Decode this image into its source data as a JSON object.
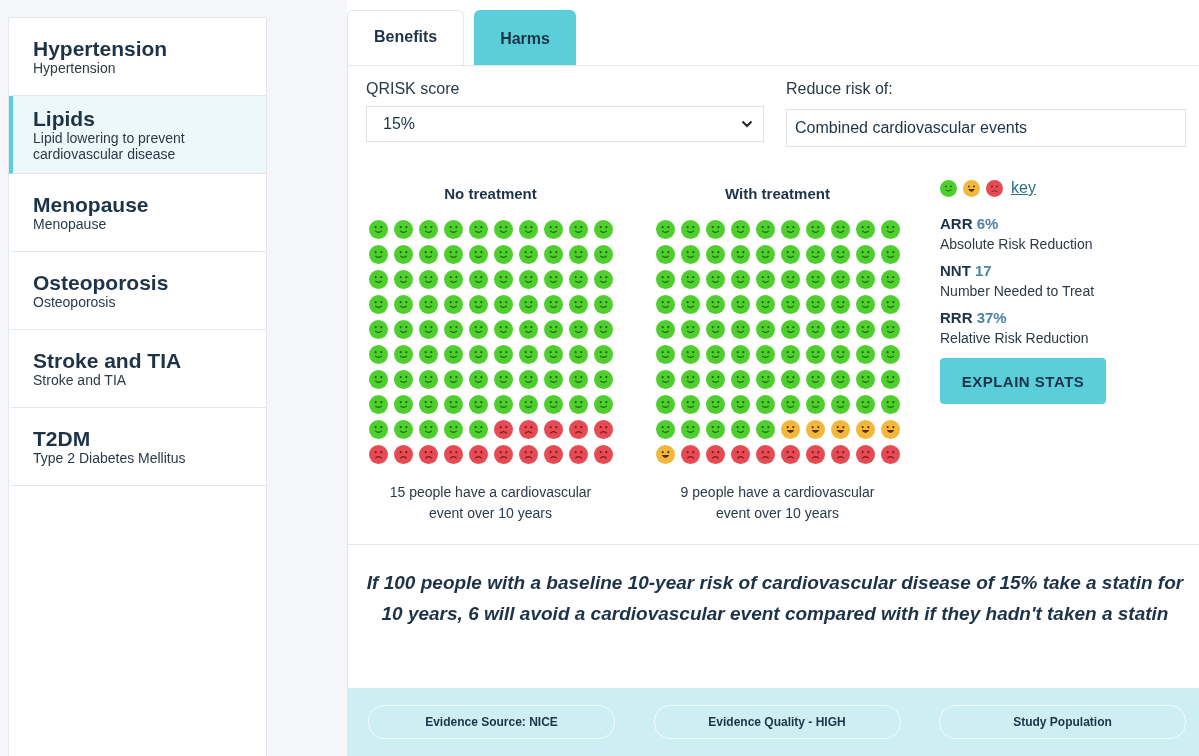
{
  "sidebar": {
    "items": [
      {
        "title": "Hypertension",
        "subtitle": "Hypertension",
        "selected": false
      },
      {
        "title": "Lipids",
        "subtitle": "Lipid lowering to prevent cardiovascular disease",
        "selected": true
      },
      {
        "title": "Menopause",
        "subtitle": "Menopause",
        "selected": false
      },
      {
        "title": "Osteoporosis",
        "subtitle": "Osteoporosis",
        "selected": false
      },
      {
        "title": "Stroke and TIA",
        "subtitle": "Stroke and TIA",
        "selected": false
      },
      {
        "title": "T2DM",
        "subtitle": "Type 2 Diabetes Mellitus",
        "selected": false
      }
    ]
  },
  "tabs": [
    {
      "label": "Benefits",
      "selected": true
    },
    {
      "label": "Harms",
      "selected": false
    }
  ],
  "form": {
    "qrisk": {
      "label": "QRISK score",
      "value": "15%"
    },
    "reduce": {
      "label": "Reduce risk of:",
      "value": "Combined cardiovascular events"
    }
  },
  "grids": [
    {
      "title": "No treatment",
      "caption": "15 people have a cardiovascular event over 10 years",
      "rows": [
        [
          {
            "kind": "smile"
          },
          {
            "kind": "smile"
          },
          {
            "kind": "smile"
          },
          {
            "kind": "smile"
          },
          {
            "kind": "smile"
          },
          {
            "kind": "smile"
          },
          {
            "kind": "smile"
          },
          {
            "kind": "smile"
          },
          {
            "kind": "smile"
          },
          {
            "kind": "smile"
          }
        ],
        [
          {
            "kind": "smile"
          },
          {
            "kind": "smile"
          },
          {
            "kind": "smile"
          },
          {
            "kind": "smile"
          },
          {
            "kind": "smile"
          },
          {
            "kind": "smile"
          },
          {
            "kind": "smile"
          },
          {
            "kind": "smile"
          },
          {
            "kind": "smile"
          },
          {
            "kind": "smile"
          }
        ],
        [
          {
            "kind": "smile"
          },
          {
            "kind": "smile"
          },
          {
            "kind": "smile"
          },
          {
            "kind": "smile"
          },
          {
            "kind": "smile"
          },
          {
            "kind": "smile"
          },
          {
            "kind": "smile"
          },
          {
            "kind": "smile"
          },
          {
            "kind": "smile"
          },
          {
            "kind": "smile"
          }
        ],
        [
          {
            "kind": "smile"
          },
          {
            "kind": "smile"
          },
          {
            "kind": "smile"
          },
          {
            "kind": "smile"
          },
          {
            "kind": "smile"
          },
          {
            "kind": "smile"
          },
          {
            "kind": "smile"
          },
          {
            "kind": "smile"
          },
          {
            "kind": "smile"
          },
          {
            "kind": "smile"
          }
        ],
        [
          {
            "kind": "smile"
          },
          {
            "kind": "smile"
          },
          {
            "kind": "smile"
          },
          {
            "kind": "smile"
          },
          {
            "kind": "smile"
          },
          {
            "kind": "smile"
          },
          {
            "kind": "smile"
          },
          {
            "kind": "smile"
          },
          {
            "kind": "smile"
          },
          {
            "kind": "smile"
          }
        ],
        [
          {
            "kind": "smile"
          },
          {
            "kind": "smile"
          },
          {
            "kind": "smile"
          },
          {
            "kind": "smile"
          },
          {
            "kind": "smile"
          },
          {
            "kind": "smile"
          },
          {
            "kind": "smile"
          },
          {
            "kind": "smile"
          },
          {
            "kind": "smile"
          },
          {
            "kind": "smile"
          }
        ],
        [
          {
            "kind": "smile"
          },
          {
            "kind": "smile"
          },
          {
            "kind": "smile"
          },
          {
            "kind": "smile"
          },
          {
            "kind": "smile"
          },
          {
            "kind": "smile"
          },
          {
            "kind": "smile"
          },
          {
            "kind": "smile"
          },
          {
            "kind": "smile"
          },
          {
            "kind": "smile"
          }
        ],
        [
          {
            "kind": "smile"
          },
          {
            "kind": "smile"
          },
          {
            "kind": "smile"
          },
          {
            "kind": "smile"
          },
          {
            "kind": "smile"
          },
          {
            "kind": "smile"
          },
          {
            "kind": "smile"
          },
          {
            "kind": "smile"
          },
          {
            "kind": "smile"
          },
          {
            "kind": "smile"
          }
        ],
        [
          {
            "kind": "smile"
          },
          {
            "kind": "smile"
          },
          {
            "kind": "smile"
          },
          {
            "kind": "smile"
          },
          {
            "kind": "smile"
          },
          {
            "kind": "frown"
          },
          {
            "kind": "frown"
          },
          {
            "kind": "frown"
          },
          {
            "kind": "frown"
          },
          {
            "kind": "frown"
          }
        ],
        [
          {
            "kind": "frown"
          },
          {
            "kind": "frown"
          },
          {
            "kind": "frown"
          },
          {
            "kind": "frown"
          },
          {
            "kind": "frown"
          },
          {
            "kind": "frown"
          },
          {
            "kind": "frown"
          },
          {
            "kind": "frown"
          },
          {
            "kind": "frown"
          },
          {
            "kind": "frown"
          }
        ]
      ]
    },
    {
      "title": "With treatment",
      "caption": "9 people have a cardiovascular event over 10 years",
      "rows": [
        [
          {
            "kind": "smile"
          },
          {
            "kind": "smile"
          },
          {
            "kind": "smile"
          },
          {
            "kind": "smile"
          },
          {
            "kind": "smile"
          },
          {
            "kind": "smile"
          },
          {
            "kind": "smile"
          },
          {
            "kind": "smile"
          },
          {
            "kind": "smile"
          },
          {
            "kind": "smile"
          }
        ],
        [
          {
            "kind": "smile"
          },
          {
            "kind": "smile"
          },
          {
            "kind": "smile"
          },
          {
            "kind": "smile"
          },
          {
            "kind": "smile"
          },
          {
            "kind": "smile"
          },
          {
            "kind": "smile"
          },
          {
            "kind": "smile"
          },
          {
            "kind": "smile"
          },
          {
            "kind": "smile"
          }
        ],
        [
          {
            "kind": "smile"
          },
          {
            "kind": "smile"
          },
          {
            "kind": "smile"
          },
          {
            "kind": "smile"
          },
          {
            "kind": "smile"
          },
          {
            "kind": "smile"
          },
          {
            "kind": "smile"
          },
          {
            "kind": "smile"
          },
          {
            "kind": "smile"
          },
          {
            "kind": "smile"
          }
        ],
        [
          {
            "kind": "smile"
          },
          {
            "kind": "smile"
          },
          {
            "kind": "smile"
          },
          {
            "kind": "smile"
          },
          {
            "kind": "smile"
          },
          {
            "kind": "smile"
          },
          {
            "kind": "smile"
          },
          {
            "kind": "smile"
          },
          {
            "kind": "smile"
          },
          {
            "kind": "smile"
          }
        ],
        [
          {
            "kind": "smile"
          },
          {
            "kind": "smile"
          },
          {
            "kind": "smile"
          },
          {
            "kind": "smile"
          },
          {
            "kind": "smile"
          },
          {
            "kind": "smile"
          },
          {
            "kind": "smile"
          },
          {
            "kind": "smile"
          },
          {
            "kind": "smile"
          },
          {
            "kind": "smile"
          }
        ],
        [
          {
            "kind": "smile"
          },
          {
            "kind": "smile"
          },
          {
            "kind": "smile"
          },
          {
            "kind": "smile"
          },
          {
            "kind": "smile"
          },
          {
            "kind": "smile"
          },
          {
            "kind": "smile"
          },
          {
            "kind": "smile"
          },
          {
            "kind": "smile"
          },
          {
            "kind": "smile"
          }
        ],
        [
          {
            "kind": "smile"
          },
          {
            "kind": "smile"
          },
          {
            "kind": "smile"
          },
          {
            "kind": "smile"
          },
          {
            "kind": "smile"
          },
          {
            "kind": "smile"
          },
          {
            "kind": "smile"
          },
          {
            "kind": "smile"
          },
          {
            "kind": "smile"
          },
          {
            "kind": "smile"
          }
        ],
        [
          {
            "kind": "smile"
          },
          {
            "kind": "smile"
          },
          {
            "kind": "smile"
          },
          {
            "kind": "smile"
          },
          {
            "kind": "smile"
          },
          {
            "kind": "smile"
          },
          {
            "kind": "smile"
          },
          {
            "kind": "smile"
          },
          {
            "kind": "smile"
          },
          {
            "kind": "smile"
          }
        ],
        [
          {
            "kind": "smile"
          },
          {
            "kind": "smile"
          },
          {
            "kind": "smile"
          },
          {
            "kind": "smile"
          },
          {
            "kind": "smile"
          },
          {
            "kind": "grin"
          },
          {
            "kind": "grin"
          },
          {
            "kind": "grin"
          },
          {
            "kind": "grin"
          },
          {
            "kind": "grin"
          }
        ],
        [
          {
            "kind": "grin"
          },
          {
            "kind": "frown"
          },
          {
            "kind": "frown"
          },
          {
            "kind": "frown"
          },
          {
            "kind": "frown"
          },
          {
            "kind": "frown"
          },
          {
            "kind": "frown"
          },
          {
            "kind": "frown"
          },
          {
            "kind": "frown"
          },
          {
            "kind": "frown"
          }
        ]
      ]
    }
  ],
  "key": {
    "faces": [
      {
        "kind": "smile"
      },
      {
        "kind": "grin"
      },
      {
        "kind": "frown"
      }
    ],
    "link": "key"
  },
  "stats": [
    {
      "abbr": "ARR",
      "value": "6%",
      "description": "Absolute Risk Reduction"
    },
    {
      "abbr": "NNT",
      "value": "17",
      "description": "Number Needed to Treat"
    },
    {
      "abbr": "RRR",
      "value": "37%",
      "description": "Relative Risk Reduction"
    }
  ],
  "explain_button": "EXPLAIN STATS",
  "summary": "If 100 people with a baseline 10-year risk of cardiovascular disease of 15% take a statin for 10 years, 6 will avoid a cardiovascular event compared with if they hadn't taken a statin",
  "footer": {
    "pills": [
      "Evidence Source: NICE",
      "Evidence Quality - HIGH",
      "Study Population"
    ]
  }
}
